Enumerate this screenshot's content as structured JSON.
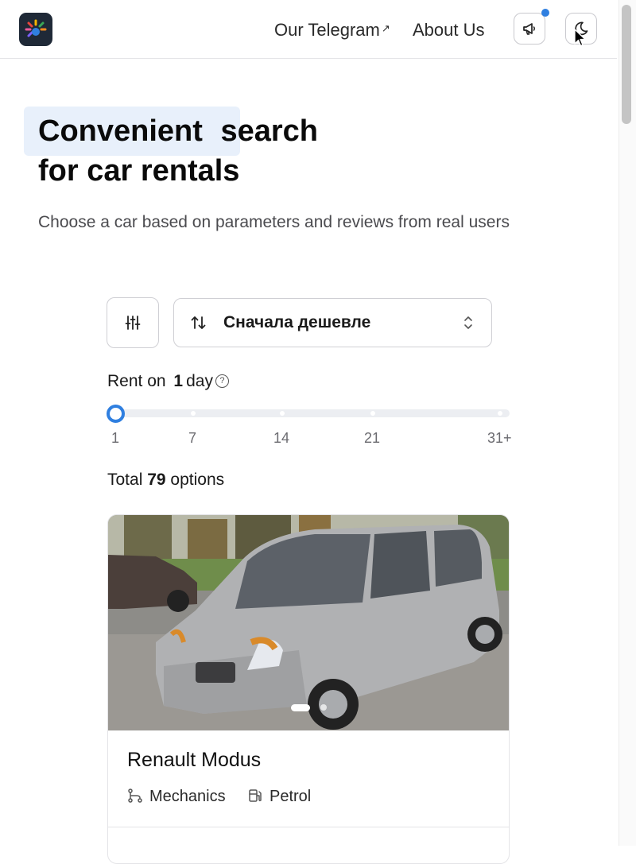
{
  "header": {
    "telegram_label": "Our Telegram",
    "about_label": "About Us",
    "external_icon": "external-link-icon",
    "announce_icon": "megaphone-icon",
    "theme_icon": "moon-icon",
    "notification_color": "#2f7fe0"
  },
  "hero": {
    "title_highlight": "Convenient",
    "title_rest_1": "search",
    "title_rest_2": "for car rentals",
    "subtitle": "Choose a car based on parameters and reviews from real users"
  },
  "controls": {
    "filter_icon": "sliders-icon",
    "sort_icon": "sort-arrows-icon",
    "sort_value": "Сначала дешевле"
  },
  "rent": {
    "prefix": "Rent on",
    "days": "1",
    "suffix": "day",
    "help_icon": "question-circle-icon",
    "slider_value": 1,
    "slider_marks": [
      "1",
      "7",
      "14",
      "21",
      "31+"
    ]
  },
  "total": {
    "prefix": "Total",
    "count": "79",
    "suffix": "options"
  },
  "listing": {
    "name": "Renault Modus",
    "transmission": "Mechanics",
    "fuel": "Petrol",
    "transmission_icon": "gearbox-icon",
    "fuel_icon": "fuel-pump-icon",
    "photo_slide": 1
  },
  "accent": "#2f7fe0"
}
